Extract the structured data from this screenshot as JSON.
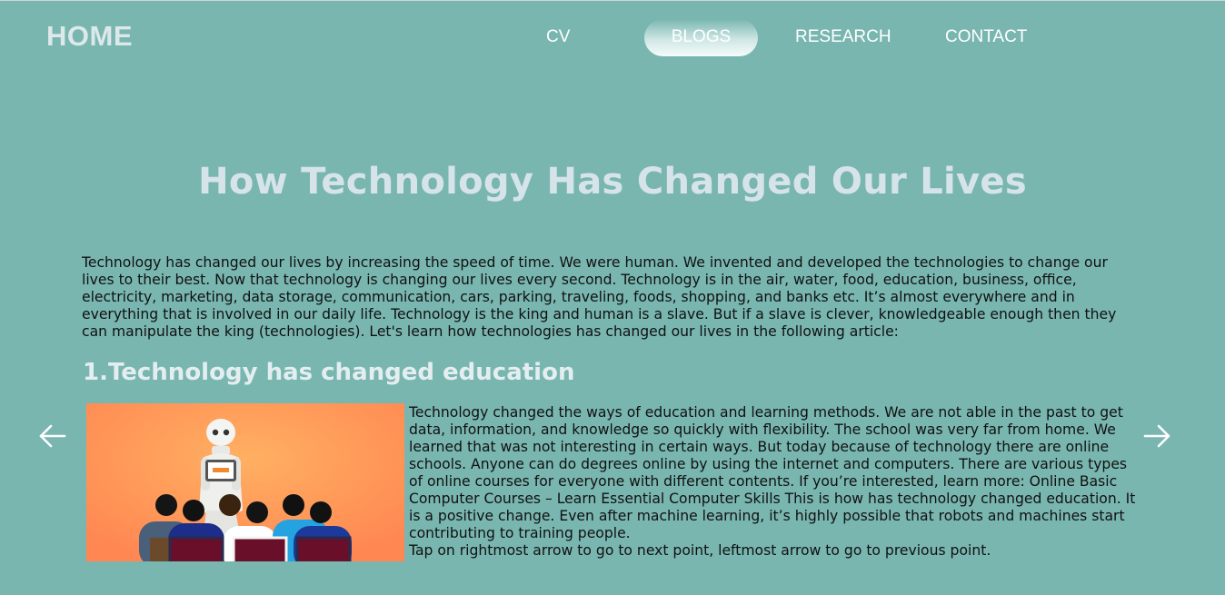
{
  "nav": {
    "home": "HOME",
    "items": [
      {
        "label": "CV"
      },
      {
        "label": "BLOGS"
      },
      {
        "label": "RESEARCH"
      },
      {
        "label": "CONTACT"
      }
    ],
    "active_item": "BLOGS"
  },
  "article": {
    "title": "How Technology Has Changed Our Lives",
    "intro": "Technology has changed our lives by increasing the speed of time. We were human. We invented and developed the technologies to change our lives to their best. Now that technology is changing our lives every second. Technology is in the air, water, food, education, business, office, electricity, marketing, data storage, communication, cars, parking, traveling, foods, shopping, and banks etc. It’s almost everywhere and in everything that is involved in our daily life. Technology is the king and human is a slave. But if a slave is clever, knowledgeable enough then they can manipulate the king (technologies). Let's learn how technologies has changed our lives in the following article:",
    "section": {
      "heading": "1.Technology has changed education",
      "body": "Technology changed the ways of education and learning methods. We are not able in the past to get data, information, and knowledge so quickly with flexibility. The school was very far from home. We learned that was not interesting in certain ways. But today because of technology there are online schools. Anyone can do degrees online by using the internet and computers. There are various types of online courses for everyone with different contents. If you’re interested, learn more: Online Basic Computer Courses – Learn Essential Computer Skills This is how has technology changed education. It is a positive change. Even after machine learning, it’s highly possible that robots and machines start contributing to training people.",
      "hint": "Tap on rightmost arrow to go to next point, leftmost arrow to go to previous point."
    }
  },
  "icons": {
    "prev": "arrow-left-icon",
    "next": "arrow-right-icon"
  },
  "colors": {
    "background": "#79b6b0",
    "title": "#d6e4ea",
    "image_background": "#ff8a4c"
  }
}
